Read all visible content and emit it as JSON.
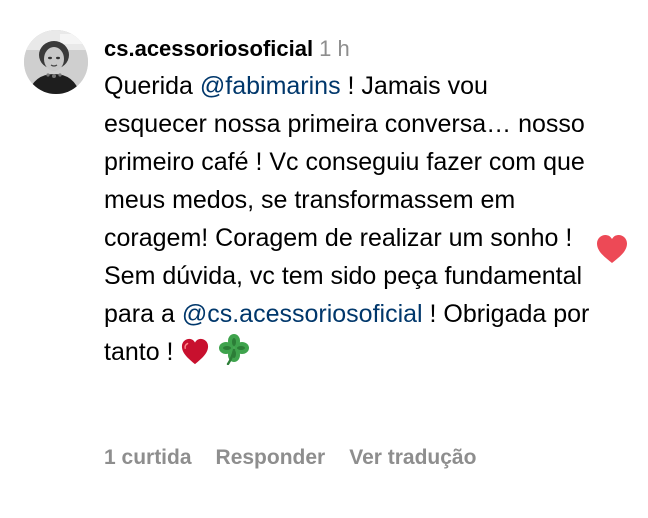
{
  "comment": {
    "username": "cs.acessoriosoficial",
    "timestamp": "1 h",
    "text": {
      "t1": "Querida ",
      "mention1": "@fabimarins",
      "t2": " ! Jamais vou esquecer nossa primeira conversa… nosso primeiro café ! Vc conseguiu fazer com que meus medos, se transformassem em coragem! Coragem de realizar um sonho ! Sem dúvida, vc tem sido peça fundamental para a ",
      "mention2": "@cs.acessoriosoficial",
      "t3": " ! Obrigada por tanto ! "
    },
    "emojis": [
      "heart-emoji",
      "four-leaf-clover-emoji"
    ],
    "liked": true,
    "like_color": "#ed4956"
  },
  "actions": {
    "likes": "1 curtida",
    "reply": "Responder",
    "translate": "Ver tradução"
  },
  "colors": {
    "mention": "#00376b",
    "muted": "#8e8e8e"
  }
}
